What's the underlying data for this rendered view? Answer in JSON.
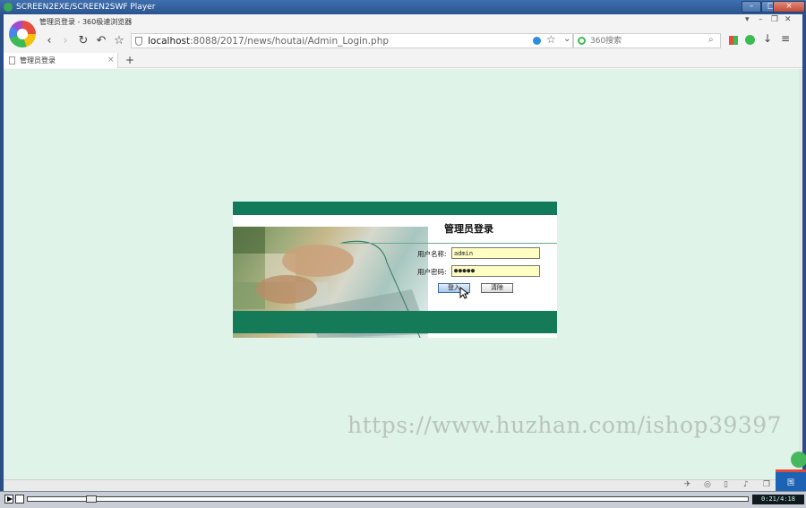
{
  "outer_window": {
    "title": "SCREEN2EXE/SCREEN2SWF Player"
  },
  "browser": {
    "page_title": "管理员登录 - 360极速浏览器",
    "address": {
      "host": "localhost",
      "path": ":8088/2017/news/houtai/Admin_Login.php"
    },
    "search_placeholder": "360搜索",
    "tab_label": "管理员登录",
    "new_tab_label": "+"
  },
  "login_form": {
    "title": "管理员登录",
    "username_label": "用户名称:",
    "username_value": "admin",
    "password_label": "用户密码:",
    "password_value": "●●●●●",
    "login_button": "登入",
    "clear_button": "清除"
  },
  "watermark": "https://www.huzhan.com/ishop39397",
  "player": {
    "time": "0:21/4:18"
  },
  "side_badge": "国",
  "colors": {
    "page_bg": "#dff3e8",
    "panel_green": "#117a5a",
    "input_bg": "#ffffc4"
  }
}
